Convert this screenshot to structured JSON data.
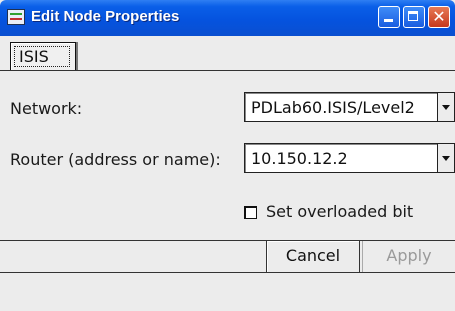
{
  "window": {
    "title": "Edit Node Properties"
  },
  "titlebar_buttons": [
    "minimize",
    "maximize",
    "close"
  ],
  "tabs": [
    {
      "label": "ISIS",
      "selected": true
    }
  ],
  "form": {
    "network": {
      "label": "Network:",
      "value": "PDLab60.ISIS/Level2"
    },
    "router": {
      "label": "Router (address or name):",
      "value": "10.150.12.2"
    },
    "overloaded": {
      "label": "Set overloaded bit",
      "checked": false
    }
  },
  "actions": {
    "cancel": "Cancel",
    "apply": "Apply",
    "apply_enabled": false
  },
  "colors": {
    "titlebar": "#0553df",
    "close_button": "#c7381c",
    "background": "#ececec"
  }
}
